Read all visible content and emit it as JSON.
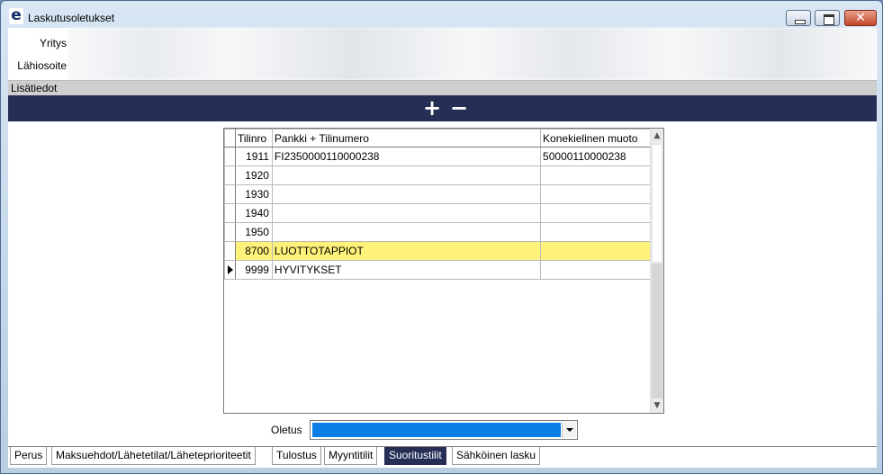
{
  "window": {
    "title": "Laskutusoletukset",
    "app_icon_letter": "e",
    "close_glyph": "✕"
  },
  "header": {
    "yritys_label": "Yritys",
    "lahiosoite_label": "Lähiosoite"
  },
  "section": {
    "lisatiedot_label": "Lisätiedot"
  },
  "toolbar": {
    "add_label": "+",
    "remove_label": "−"
  },
  "grid": {
    "columns": {
      "tilinro": "Tilinro",
      "pankki": "Pankki + Tilinumero",
      "konekielinen": "Konekielinen muoto"
    },
    "rows": [
      {
        "tilinro": "1911",
        "pankki": "FI2350000110000238",
        "konekielinen": "50000110000238"
      },
      {
        "tilinro": "1920",
        "pankki": "",
        "konekielinen": ""
      },
      {
        "tilinro": "1930",
        "pankki": "",
        "konekielinen": ""
      },
      {
        "tilinro": "1940",
        "pankki": "",
        "konekielinen": ""
      },
      {
        "tilinro": "1950",
        "pankki": "",
        "konekielinen": ""
      },
      {
        "tilinro": "8700",
        "pankki": "LUOTTOTAPPIOT",
        "konekielinen": ""
      },
      {
        "tilinro": "9999",
        "pankki": "HYVITYKSET",
        "konekielinen": ""
      }
    ],
    "highlighted_row_color": "#fff27a",
    "scroll_up_glyph": "▲",
    "scroll_down_glyph": "▼"
  },
  "oletus": {
    "label": "Oletus",
    "selected_value": "",
    "selected_color": "#0a7de6"
  },
  "tabs": [
    {
      "label": "Perus"
    },
    {
      "label": "Maksuehdot/Lähetetilat/Läheteprioriteetit"
    },
    {
      "label": "Tulostus"
    },
    {
      "label": "Myyntitilit"
    },
    {
      "label": "Suoritustilit",
      "active": true
    },
    {
      "label": "Sähköinen lasku"
    }
  ],
  "colors": {
    "toolbar_bg": "#262e55",
    "active_tab_bg": "#262e55"
  }
}
